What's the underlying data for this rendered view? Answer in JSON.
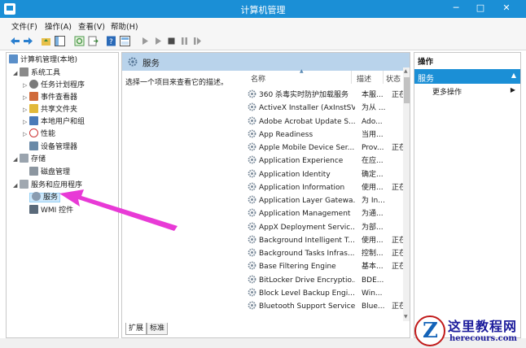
{
  "window": {
    "title": "计算机管理",
    "minimize": "─",
    "maximize": "□",
    "close": "✕"
  },
  "menu": [
    "文件(F)",
    "操作(A)",
    "查看(V)",
    "帮助(H)"
  ],
  "tree": {
    "root": "计算机管理(本地)",
    "items": [
      "系统工具",
      "任务计划程序",
      "事件查看器",
      "共享文件夹",
      "本地用户和组",
      "性能",
      "设备管理器",
      "存储",
      "磁盘管理",
      "服务和应用程序",
      "服务",
      "WMI 控件"
    ]
  },
  "center": {
    "title": "服务",
    "description": "选择一个项目来查看它的描述。",
    "columns": {
      "name": "名称",
      "desc": "描述",
      "status": "状态"
    },
    "services": [
      {
        "name": "360 杀毒实时防护加载服务",
        "desc": "本服...",
        "status": "正在..."
      },
      {
        "name": "ActiveX Installer (AxInstSV)",
        "desc": "为从 ...",
        "status": ""
      },
      {
        "name": "Adobe Acrobat Update S...",
        "desc": "Ado...",
        "status": ""
      },
      {
        "name": "App Readiness",
        "desc": "当用...",
        "status": ""
      },
      {
        "name": "Apple Mobile Device Ser...",
        "desc": "Prov...",
        "status": "正在..."
      },
      {
        "name": "Application Experience",
        "desc": "在应...",
        "status": ""
      },
      {
        "name": "Application Identity",
        "desc": "确定...",
        "status": ""
      },
      {
        "name": "Application Information",
        "desc": "使用...",
        "status": "正在..."
      },
      {
        "name": "Application Layer Gatewa...",
        "desc": "为 In...",
        "status": ""
      },
      {
        "name": "Application Management",
        "desc": "为通...",
        "status": ""
      },
      {
        "name": "AppX Deployment Servic...",
        "desc": "为部...",
        "status": ""
      },
      {
        "name": "Background Intelligent T...",
        "desc": "使用...",
        "status": "正在..."
      },
      {
        "name": "Background Tasks Infras...",
        "desc": "控制...",
        "status": "正在..."
      },
      {
        "name": "Base Filtering Engine",
        "desc": "基本...",
        "status": "正在..."
      },
      {
        "name": "BitLocker Drive Encryptio...",
        "desc": "BDE...",
        "status": ""
      },
      {
        "name": "Block Level Backup Engi...",
        "desc": "Win...",
        "status": ""
      },
      {
        "name": "Bluetooth Support Service",
        "desc": "Blue...",
        "status": "正在..."
      }
    ],
    "tabs": [
      "扩展",
      "标准"
    ]
  },
  "actions": {
    "header": "操作",
    "section": "服务",
    "more": "更多操作"
  },
  "watermark": {
    "title": "这里教程网",
    "url": "herecours.com"
  },
  "colors": {
    "titlebar": "#1b8fd6",
    "selection": "#cde8fb",
    "arrow": "#e83ad6",
    "header": "#b9d3eb"
  }
}
